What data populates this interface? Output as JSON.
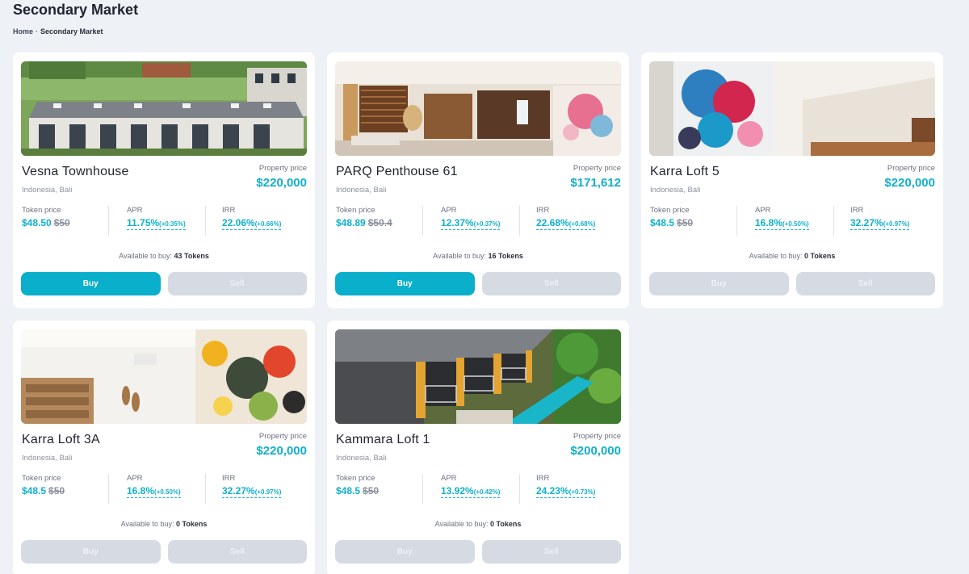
{
  "page": {
    "title": "Secondary Market",
    "breadcrumb": {
      "home": "Home",
      "separator": "·",
      "current": "Secondary Market"
    }
  },
  "colors": {
    "accent": "#0fb0cc",
    "buy_active": "#0aafcc",
    "disabled": "#d6dae3"
  },
  "labels": {
    "property_price": "Property price",
    "token_price": "Token price",
    "apr": "APR",
    "irr": "IRR",
    "available_prefix": "Available to buy:",
    "buy": "Buy",
    "sell": "Sell"
  },
  "listings": [
    {
      "name": "Vesna Townhouse",
      "location": "Indonesia, Bali",
      "price": "$220,000",
      "token_price": "$48.50",
      "token_old_price": "$50",
      "apr": "11.75%",
      "apr_delta": "(+0.35%)",
      "irr": "22.06%",
      "irr_delta": "(+0.66%)",
      "available": "43 Tokens",
      "buy_enabled": true
    },
    {
      "name": "PARQ Penthouse 61",
      "location": "Indonesia, Bali",
      "price": "$171,612",
      "token_price": "$48.89",
      "token_old_price": "$50.4",
      "apr": "12.37%",
      "apr_delta": "(+0.37%)",
      "irr": "22.68%",
      "irr_delta": "(+0.68%)",
      "available": "16 Tokens",
      "buy_enabled": true
    },
    {
      "name": "Karra Loft 5",
      "location": "Indonesia, Bali",
      "price": "$220,000",
      "token_price": "$48.5",
      "token_old_price": "$50",
      "apr": "16.8%",
      "apr_delta": "(+0.50%)",
      "irr": "32.27%",
      "irr_delta": "(+0.97%)",
      "available": "0 Tokens",
      "buy_enabled": false
    },
    {
      "name": "Karra Loft 3A",
      "location": "Indonesia, Bali",
      "price": "$220,000",
      "token_price": "$48.5",
      "token_old_price": "$50",
      "apr": "16.8%",
      "apr_delta": "(+0.50%)",
      "irr": "32.27%",
      "irr_delta": "(+0.97%)",
      "available": "0 Tokens",
      "buy_enabled": false
    },
    {
      "name": "Kammara Loft 1",
      "location": "Indonesia, Bali",
      "price": "$200,000",
      "token_price": "$48.5",
      "token_old_price": "$50",
      "apr": "13.92%",
      "apr_delta": "(+0.42%)",
      "irr": "24.23%",
      "irr_delta": "(+0.73%)",
      "available": "0 Tokens",
      "buy_enabled": false
    }
  ]
}
